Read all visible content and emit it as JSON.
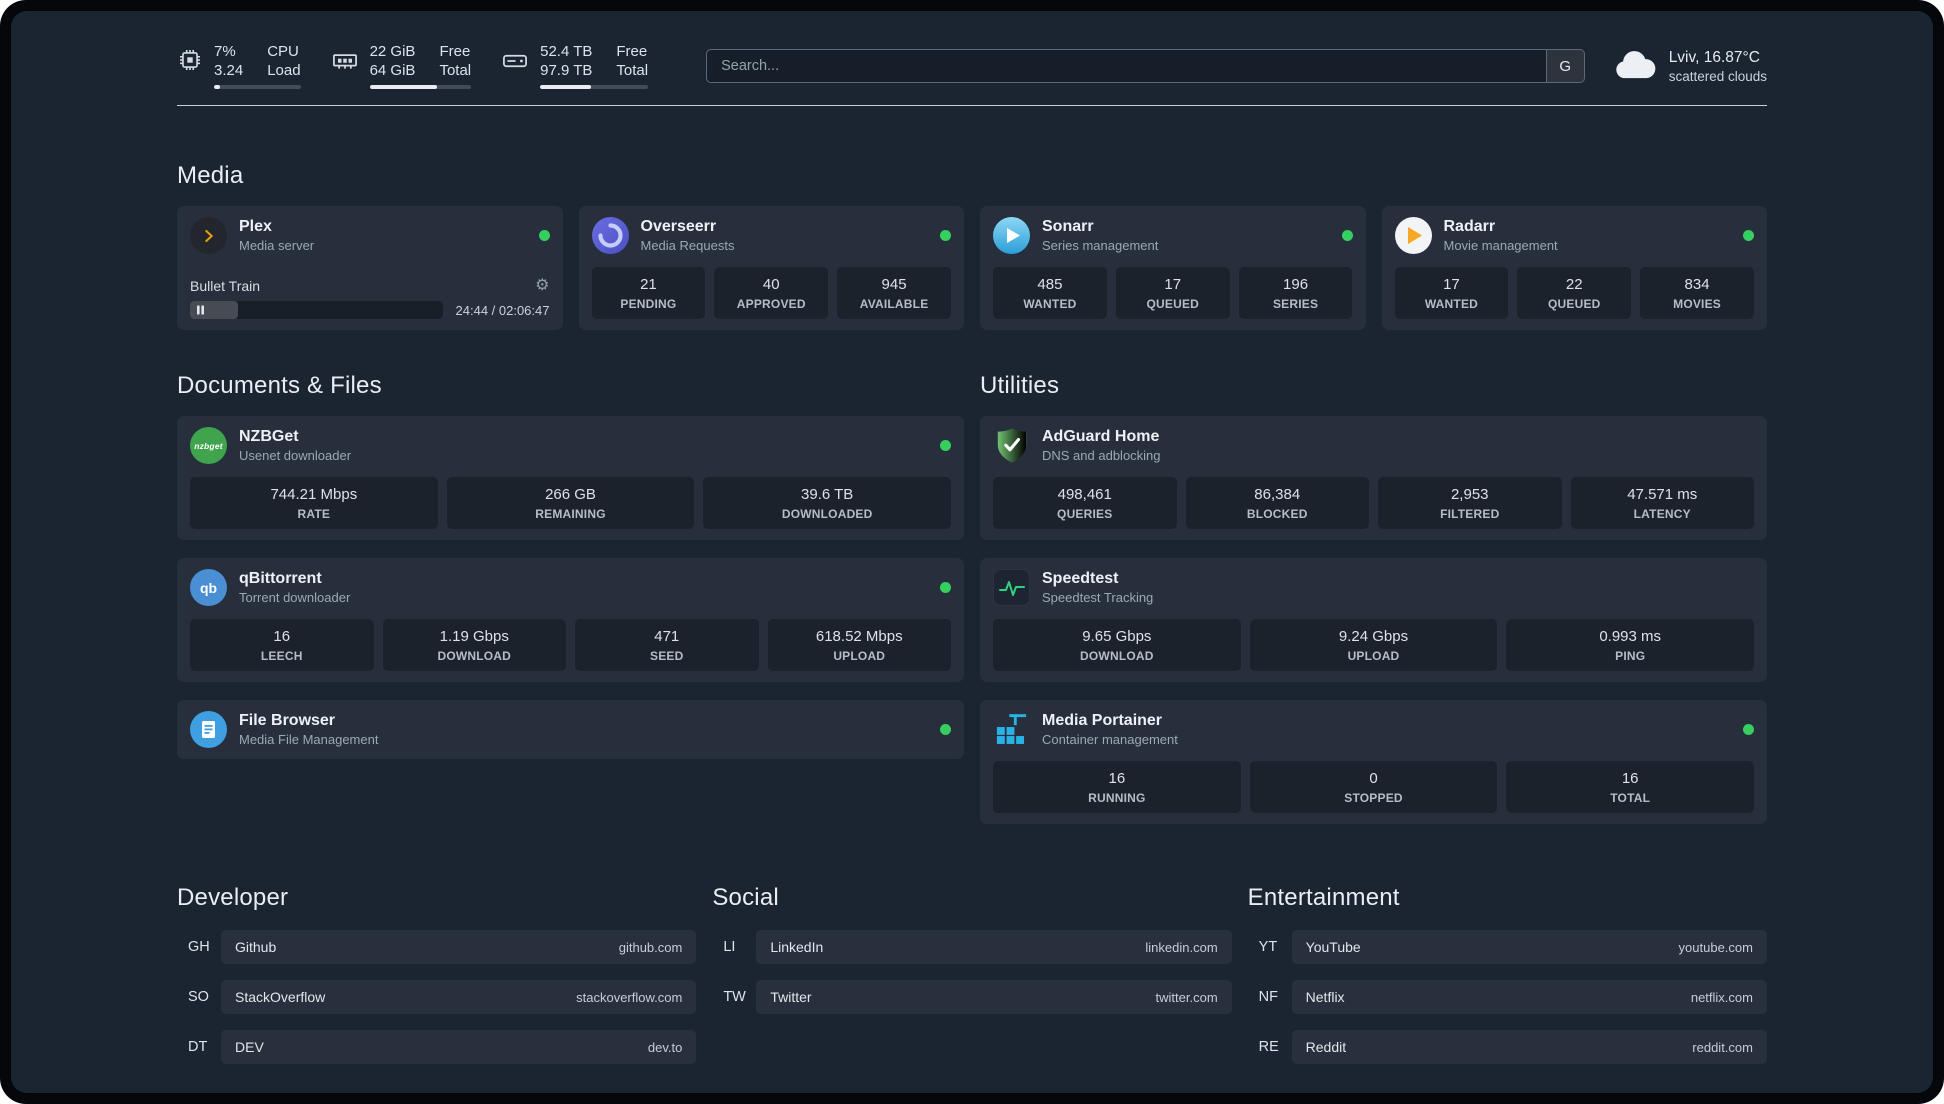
{
  "topbar": {
    "cpu": {
      "value1": "7%",
      "value2": "3.24",
      "label1": "CPU",
      "label2": "Load",
      "bar_percent": 7
    },
    "memory": {
      "value1": "22 GiB",
      "value2": "64 GiB",
      "label1": "Free",
      "label2": "Total",
      "bar_percent": 66
    },
    "disk": {
      "value1": "52.4 TB",
      "value2": "97.9 TB",
      "label1": "Free",
      "label2": "Total",
      "bar_percent": 47
    },
    "search": {
      "placeholder": "Search...",
      "button_label": "G"
    },
    "weather": {
      "location": "Lviv, 16.87°C",
      "condition": "scattered clouds"
    }
  },
  "sections": {
    "media": "Media",
    "documents": "Documents & Files",
    "utilities": "Utilities",
    "developer": "Developer",
    "social": "Social",
    "entertainment": "Entertainment"
  },
  "services": {
    "plex": {
      "name": "Plex",
      "desc": "Media server",
      "player": {
        "title": "Bullet Train",
        "time": "24:44 / 02:06:47",
        "progress_percent": 19
      }
    },
    "overseerr": {
      "name": "Overseerr",
      "desc": "Media Requests",
      "stats": [
        {
          "value": "21",
          "label": "PENDING"
        },
        {
          "value": "40",
          "label": "APPROVED"
        },
        {
          "value": "945",
          "label": "AVAILABLE"
        }
      ]
    },
    "sonarr": {
      "name": "Sonarr",
      "desc": "Series management",
      "stats": [
        {
          "value": "485",
          "label": "WANTED"
        },
        {
          "value": "17",
          "label": "QUEUED"
        },
        {
          "value": "196",
          "label": "SERIES"
        }
      ]
    },
    "radarr": {
      "name": "Radarr",
      "desc": "Movie management",
      "stats": [
        {
          "value": "17",
          "label": "WANTED"
        },
        {
          "value": "22",
          "label": "QUEUED"
        },
        {
          "value": "834",
          "label": "MOVIES"
        }
      ]
    },
    "nzbget": {
      "name": "NZBGet",
      "desc": "Usenet downloader",
      "icon_text": "nzbget",
      "stats": [
        {
          "value": "744.21 Mbps",
          "label": "RATE"
        },
        {
          "value": "266 GB",
          "label": "REMAINING"
        },
        {
          "value": "39.6 TB",
          "label": "DOWNLOADED"
        }
      ]
    },
    "qbittorrent": {
      "name": "qBittorrent",
      "desc": "Torrent downloader",
      "icon_text": "qb",
      "stats": [
        {
          "value": "16",
          "label": "LEECH"
        },
        {
          "value": "1.19 Gbps",
          "label": "DOWNLOAD"
        },
        {
          "value": "471",
          "label": "SEED"
        },
        {
          "value": "618.52 Mbps",
          "label": "UPLOAD"
        }
      ]
    },
    "filebrowser": {
      "name": "File Browser",
      "desc": "Media File Management"
    },
    "adguard": {
      "name": "AdGuard Home",
      "desc": "DNS and adblocking",
      "stats": [
        {
          "value": "498,461",
          "label": "QUERIES"
        },
        {
          "value": "86,384",
          "label": "BLOCKED"
        },
        {
          "value": "2,953",
          "label": "FILTERED"
        },
        {
          "value": "47.571 ms",
          "label": "LATENCY"
        }
      ]
    },
    "speedtest": {
      "name": "Speedtest",
      "desc": "Speedtest Tracking",
      "stats": [
        {
          "value": "9.65 Gbps",
          "label": "DOWNLOAD"
        },
        {
          "value": "9.24 Gbps",
          "label": "UPLOAD"
        },
        {
          "value": "0.993 ms",
          "label": "PING"
        }
      ]
    },
    "portainer": {
      "name": "Media Portainer",
      "desc": "Container management",
      "stats": [
        {
          "value": "16",
          "label": "RUNNING"
        },
        {
          "value": "0",
          "label": "STOPPED"
        },
        {
          "value": "16",
          "label": "TOTAL"
        }
      ]
    }
  },
  "bookmarks": {
    "developer": [
      {
        "abbr": "GH",
        "name": "Github",
        "url": "github.com"
      },
      {
        "abbr": "SO",
        "name": "StackOverflow",
        "url": "stackoverflow.com"
      },
      {
        "abbr": "DT",
        "name": "DEV",
        "url": "dev.to"
      }
    ],
    "social": [
      {
        "abbr": "LI",
        "name": "LinkedIn",
        "url": "linkedin.com"
      },
      {
        "abbr": "TW",
        "name": "Twitter",
        "url": "twitter.com"
      }
    ],
    "entertainment": [
      {
        "abbr": "YT",
        "name": "YouTube",
        "url": "youtube.com"
      },
      {
        "abbr": "NF",
        "name": "Netflix",
        "url": "netflix.com"
      },
      {
        "abbr": "RE",
        "name": "Reddit",
        "url": "reddit.com"
      }
    ]
  },
  "icons": {
    "gear": "⚙"
  },
  "colors": {
    "status_green": "#35cf60",
    "plex_amber": "#e5a00d",
    "background": "#1b2431",
    "divider": "#c7ced6"
  }
}
